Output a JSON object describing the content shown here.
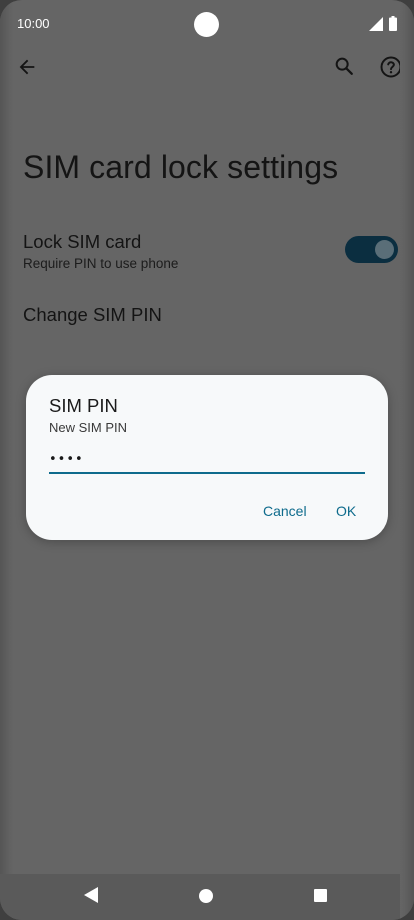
{
  "status_bar": {
    "time": "10:00",
    "icons": [
      "camera-cutout",
      "signal-icon",
      "battery-icon"
    ]
  },
  "app_bar": {
    "icons": [
      "back-arrow-icon",
      "search-icon",
      "help-icon"
    ]
  },
  "page": {
    "title": "SIM card lock settings"
  },
  "settings": {
    "lock_sim": {
      "title": "Lock SIM card",
      "subtitle": "Require PIN to use phone",
      "enabled": true
    },
    "change_pin": {
      "title": "Change SIM PIN"
    }
  },
  "dialog": {
    "title": "SIM PIN",
    "subtitle": "New SIM PIN",
    "input_value": "••••",
    "cancel_label": "Cancel",
    "ok_label": "OK"
  },
  "nav_bar": {
    "icons": [
      "back-triangle-icon",
      "home-circle-icon",
      "recents-square-icon"
    ]
  },
  "colors": {
    "scrim_background": "#656565",
    "dialog_background": "#f7f9fa",
    "accent": "#0e6b8c",
    "toggle_track": "#0b2e40"
  }
}
